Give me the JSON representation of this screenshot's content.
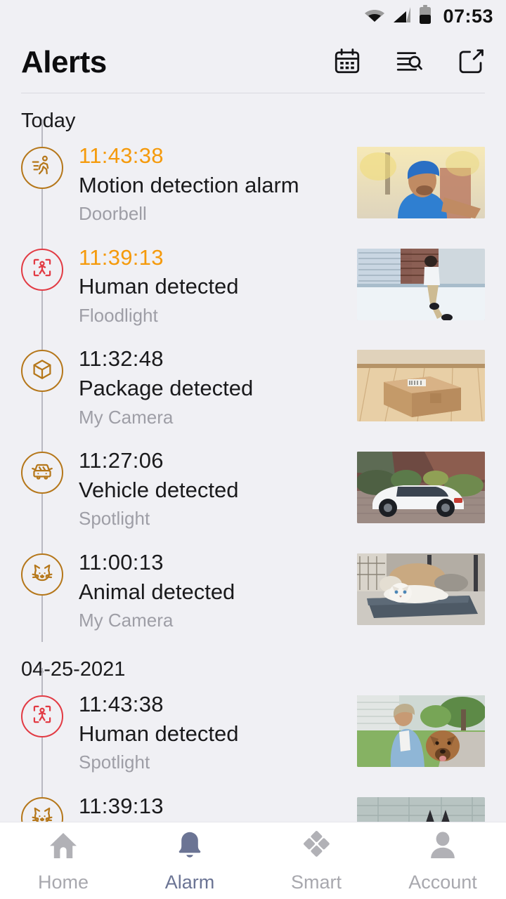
{
  "status_bar": {
    "time": "07:53",
    "icons": [
      "wifi-icon",
      "cellular-signal-icon",
      "battery-icon"
    ],
    "battery_level_percent": 50
  },
  "header": {
    "title": "Alerts",
    "actions": [
      {
        "name": "calendar-icon",
        "label": "Calendar"
      },
      {
        "name": "filter-search-icon",
        "label": "Search"
      },
      {
        "name": "edit-icon",
        "label": "Edit"
      }
    ]
  },
  "colors": {
    "background": "#f0f0f4",
    "accent_amber": "#b5771a",
    "alert_orange": "#f59a0b",
    "alert_red": "#e23b44",
    "tab_active": "#6b7494",
    "tab_inactive": "#a8a8ae",
    "muted_text": "#9e9ea6",
    "rail": "#b9b9c2"
  },
  "sections": [
    {
      "label": "Today",
      "items": [
        {
          "time": "11:43:38",
          "time_highlighted": true,
          "title": "Motion detection alarm",
          "device": "Doorbell",
          "icon": "motion-running-icon",
          "icon_color": "amber",
          "thumbnail": "delivery-person-selfie-thumbnail"
        },
        {
          "time": "11:39:13",
          "time_highlighted": true,
          "title": "Human detected",
          "device": "Floodlight",
          "icon": "human-detection-icon",
          "icon_color": "red",
          "thumbnail": "person-sitting-on-railing-thumbnail"
        },
        {
          "time": "11:32:48",
          "time_highlighted": false,
          "title": "Package detected",
          "device": "My Camera",
          "icon": "package-box-icon",
          "icon_color": "amber",
          "thumbnail": "cardboard-box-on-floor-thumbnail"
        },
        {
          "time": "11:27:06",
          "time_highlighted": false,
          "title": "Vehicle detected",
          "device": "Spotlight",
          "icon": "vehicle-car-icon",
          "icon_color": "amber",
          "thumbnail": "white-sports-car-driveway-thumbnail"
        },
        {
          "time": "11:00:13",
          "time_highlighted": false,
          "title": "Animal detected",
          "device": "My Camera",
          "icon": "animal-cat-icon",
          "icon_color": "amber",
          "thumbnail": "white-cat-on-cushion-thumbnail"
        }
      ]
    },
    {
      "label": "04-25-2021",
      "items": [
        {
          "time": "11:43:38",
          "time_highlighted": false,
          "title": "Human detected",
          "device": "Spotlight",
          "icon": "human-detection-icon",
          "icon_color": "red",
          "thumbnail": "man-with-dog-thumbnail"
        },
        {
          "time": "11:39:13",
          "time_highlighted": false,
          "title": "",
          "device": "",
          "icon": "animal-cat-icon",
          "icon_color": "amber",
          "thumbnail": "cat-outdoors-thumbnail",
          "partial": true
        }
      ]
    }
  ],
  "tabbar": {
    "active_index": 1,
    "tabs": [
      {
        "label": "Home",
        "icon": "home-icon"
      },
      {
        "label": "Alarm",
        "icon": "bell-icon"
      },
      {
        "label": "Smart",
        "icon": "diamonds-icon"
      },
      {
        "label": "Account",
        "icon": "person-icon"
      }
    ]
  }
}
